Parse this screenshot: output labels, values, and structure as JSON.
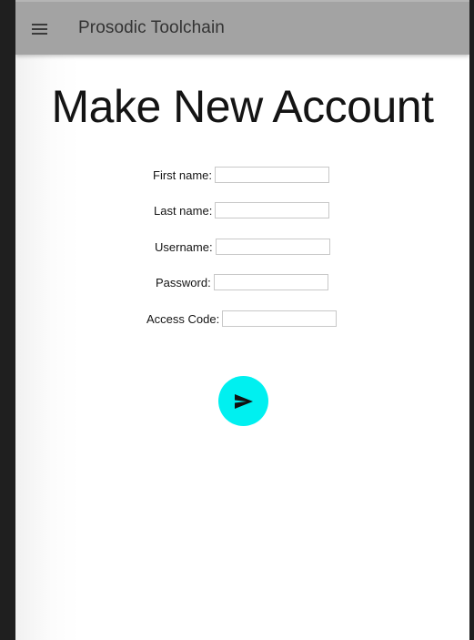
{
  "header": {
    "app_title": "Prosodic Toolchain",
    "menu_icon": "hamburger-menu-icon"
  },
  "page": {
    "title": "Make New Account"
  },
  "form": {
    "fields": [
      {
        "label": "First name:",
        "value": ""
      },
      {
        "label": "Last name:",
        "value": ""
      },
      {
        "label": "Username:",
        "value": ""
      },
      {
        "label": "Password:",
        "value": ""
      },
      {
        "label": "Access Code:",
        "value": ""
      }
    ],
    "submit_icon": "send-icon"
  },
  "colors": {
    "header_bg": "#a3a3a3",
    "submit_bg": "#00f0f0",
    "outer_bg": "#1f1f1f"
  }
}
